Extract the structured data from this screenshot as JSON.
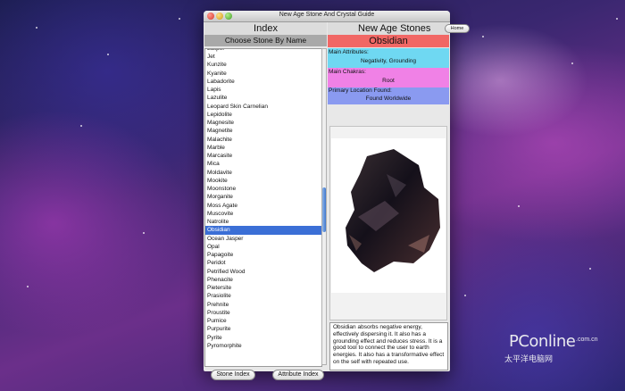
{
  "window": {
    "title": "New Age Stone And Crystal Guide"
  },
  "left_panel": {
    "heading": "Index",
    "subheading": "Choose Stone By Name",
    "items": [
      "Jet",
      "Kunzite",
      "Kyanite",
      "Labadorite",
      "Lapis",
      "Lazulite",
      "Leopard Skin Carnelian",
      "Lepidolite",
      "Magnesite",
      "Magnetite",
      "Malachite",
      "Marble",
      "Marcasite",
      "Mica",
      "Moldavite",
      "Mookite",
      "Moonstone",
      "Morganite",
      "Moss Agate",
      "Muscovite",
      "Natrolite",
      "Obsidian",
      "Ocean Jasper",
      "Opal",
      "Papagoite",
      "Peridot",
      "Petrified Wood",
      "Phenacite",
      "Pietersite",
      "Prasiolite",
      "Prehnite",
      "Proustite",
      "Pumice",
      "Purpurite",
      "Pyrite",
      "Pyromorphite"
    ],
    "selected_item": "Obsidian",
    "buttons": {
      "stone_index": "Stone Index",
      "attribute_index": "Attribute Index"
    }
  },
  "right_panel": {
    "heading": "New Age Stones",
    "home_button": "Home",
    "stone_name": "Obsidian",
    "main_attributes_label": "Main Attributes:",
    "main_attributes_value": "Negativity, Grounding",
    "main_chakras_label": "Main Chakras:",
    "main_chakras_value": "Root",
    "location_label": "Primary Location Found:",
    "location_value": "Found Worldwide",
    "description": "Obsidian absorbs negative energy, effectively dispersing it. It also has a grounding effect and reduces stress. It is a good tool to connect the user to earth energies. It also has a transformative effect on the self with repeated use.",
    "colors": {
      "stone_name": "#f16765",
      "attributes": "#6fd8f2",
      "chakras": "#f081e6",
      "location": "#8a9af0"
    }
  },
  "watermark": {
    "brand": "PConline",
    "url": ".com.cn",
    "sub": "太平洋电脑网"
  }
}
